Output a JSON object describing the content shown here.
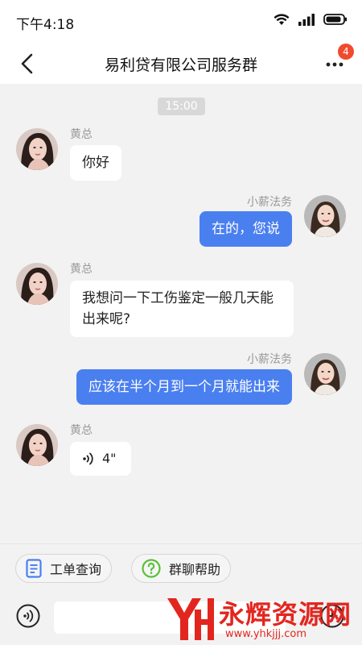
{
  "status_bar": {
    "time": "下午4:18",
    "battery_level": 0.9
  },
  "nav": {
    "title": "易利贷有限公司服务群",
    "badge_count": "4"
  },
  "chat": {
    "timestamp": "15:00",
    "messages": [
      {
        "sender": "黄总",
        "text": "你好",
        "direction": "in"
      },
      {
        "sender": "小薪法务",
        "text": "在的，您说",
        "direction": "out"
      },
      {
        "sender": "黄总",
        "text": "我想问一下工伤鉴定一般几天能出来呢?",
        "direction": "in"
      },
      {
        "sender": "小薪法务",
        "text": "应该在半个月到一个月就能出来",
        "direction": "out"
      },
      {
        "sender": "黄总",
        "text": "4\"",
        "direction": "in",
        "type": "voice"
      }
    ]
  },
  "quick_actions": [
    {
      "label": "工单查询",
      "icon": "document-icon"
    },
    {
      "label": "群聊帮助",
      "icon": "question-icon"
    }
  ],
  "input": {
    "value": "",
    "placeholder": ""
  },
  "watermark": {
    "name": "永辉资源网",
    "url": "www.yhkjjj.com",
    "logo": "YH"
  },
  "colors": {
    "accent": "#4a7ff0",
    "badge": "#f04a2f",
    "watermark": "#e2261f"
  }
}
